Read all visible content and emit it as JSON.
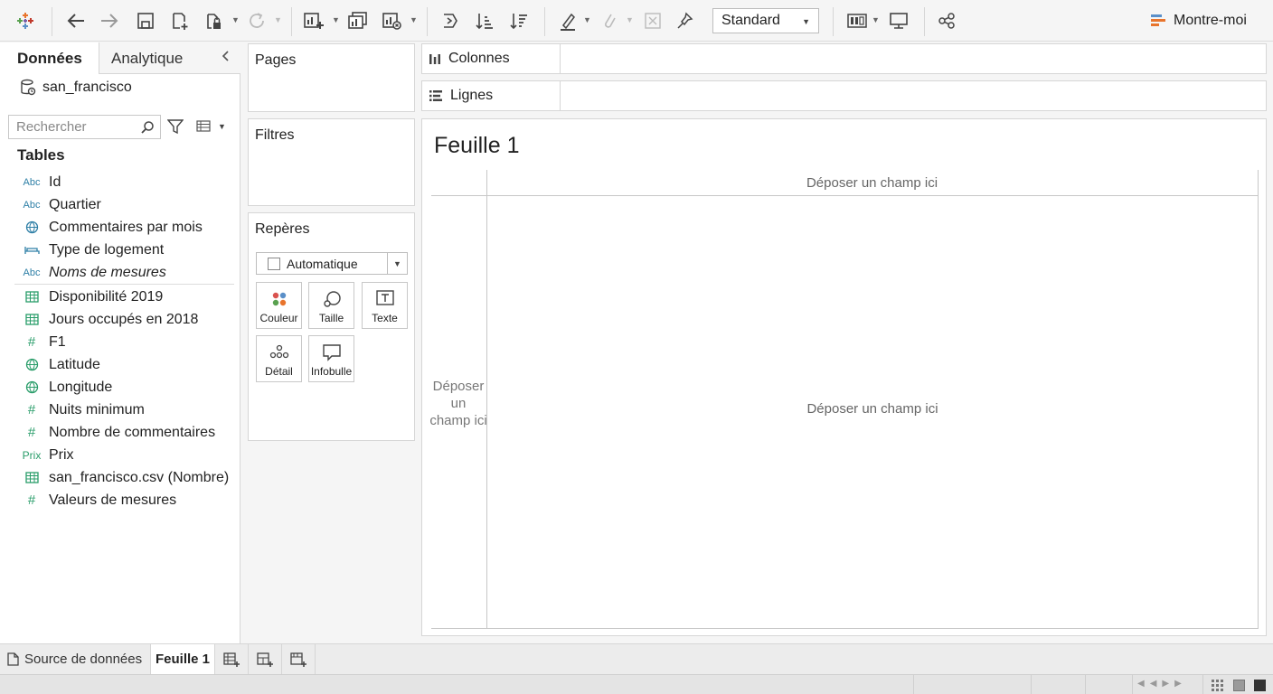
{
  "toolbar": {
    "icons": [
      "tableau-logo-icon",
      "undo-icon",
      "redo-icon",
      "save-icon",
      "new-data-source-icon",
      "pause-updates-icon",
      "refresh-icon",
      "new-worksheet-icon",
      "duplicate-sheet-icon",
      "clear-sheet-icon",
      "swap-rows-columns-icon",
      "sort-ascending-icon",
      "sort-descending-icon",
      "highlight-icon",
      "group-members-icon",
      "show-mark-labels-icon",
      "fix-axes-icon",
      "show-cards-icon",
      "presentation-mode-icon",
      "share-icon"
    ],
    "fit_value": "Standard",
    "show_me_label": "Montre-moi"
  },
  "left_panel": {
    "tab_data": "Données",
    "tab_analytics": "Analytique",
    "datasource_name": "san_francisco",
    "search_placeholder": "Rechercher",
    "tables_heading": "Tables",
    "dimensions": [
      {
        "icon": "Abc",
        "label": "Id"
      },
      {
        "icon": "Abc",
        "label": "Quartier"
      },
      {
        "icon": "globe",
        "label": "Commentaires par mois"
      },
      {
        "icon": "bed",
        "label": "Type de logement"
      },
      {
        "icon": "Abc",
        "label": "Noms de mesures"
      }
    ],
    "measures": [
      {
        "icon": "table",
        "label": "Disponibilité 2019"
      },
      {
        "icon": "table",
        "label": "Jours occupés en 2018"
      },
      {
        "icon": "#",
        "label": "F1"
      },
      {
        "icon": "globe",
        "label": "Latitude"
      },
      {
        "icon": "globe",
        "label": "Longitude"
      },
      {
        "icon": "#",
        "label": "Nuits minimum"
      },
      {
        "icon": "#",
        "label": "Nombre de commentaires"
      },
      {
        "icon": "Prix",
        "label": "Prix"
      },
      {
        "icon": "table",
        "label": "san_francisco.csv (Nombre)"
      },
      {
        "icon": "#",
        "label": "Valeurs de mesures"
      }
    ]
  },
  "cards": {
    "pages": "Pages",
    "filters": "Filtres",
    "marks": "Repères",
    "mark_type": "Automatique",
    "mark_buttons": [
      "Couleur",
      "Taille",
      "Texte",
      "Détail",
      "Infobulle"
    ]
  },
  "shelves": {
    "columns": "Colonnes",
    "rows": "Lignes"
  },
  "sheet": {
    "title": "Feuille 1",
    "drop_top": "Déposer un champ ici",
    "drop_left": "Déposer un champ ici",
    "drop_main": "Déposer un champ ici"
  },
  "bottom_tabs": {
    "data_source": "Source de données",
    "sheet1": "Feuille 1"
  },
  "colors": {
    "dimension_icon": "#2e7fa6",
    "measure_icon": "#2a9d6a",
    "show_me_accent": "#e8742c"
  }
}
